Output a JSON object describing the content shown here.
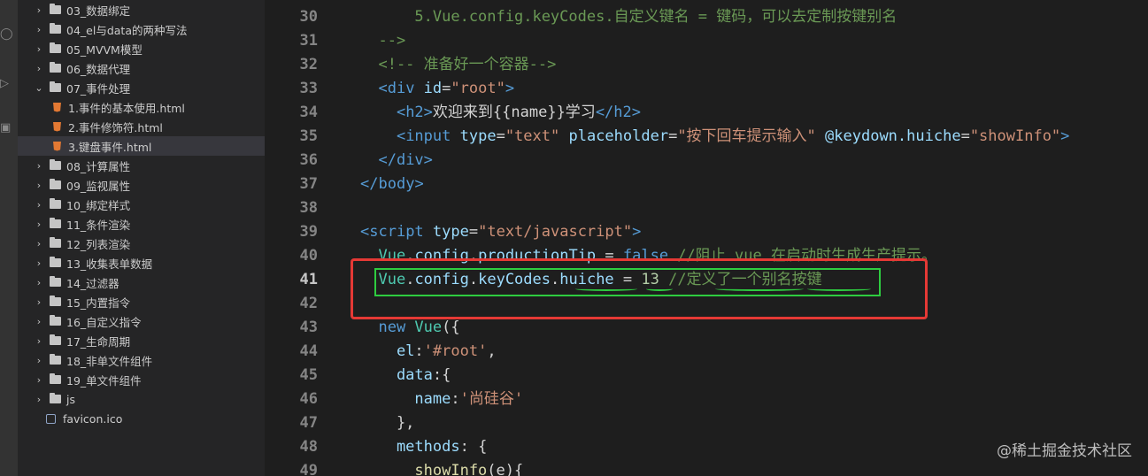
{
  "sidebar": {
    "items": [
      {
        "label": "03_数据绑定",
        "type": "folder",
        "expanded": false,
        "depth": 0
      },
      {
        "label": "04_el与data的两种写法",
        "type": "folder",
        "expanded": false,
        "depth": 0
      },
      {
        "label": "05_MVVM模型",
        "type": "folder",
        "expanded": false,
        "depth": 0
      },
      {
        "label": "06_数据代理",
        "type": "folder",
        "expanded": false,
        "depth": 0
      },
      {
        "label": "07_事件处理",
        "type": "folder",
        "expanded": true,
        "depth": 0
      },
      {
        "label": "1.事件的基本使用.html",
        "type": "html",
        "depth": 1
      },
      {
        "label": "2.事件修饰符.html",
        "type": "html",
        "depth": 1
      },
      {
        "label": "3.键盘事件.html",
        "type": "html",
        "depth": 1,
        "selected": true
      },
      {
        "label": "08_计算属性",
        "type": "folder",
        "expanded": false,
        "depth": 0
      },
      {
        "label": "09_监视属性",
        "type": "folder",
        "expanded": false,
        "depth": 0
      },
      {
        "label": "10_绑定样式",
        "type": "folder",
        "expanded": false,
        "depth": 0
      },
      {
        "label": "11_条件渲染",
        "type": "folder",
        "expanded": false,
        "depth": 0
      },
      {
        "label": "12_列表渲染",
        "type": "folder",
        "expanded": false,
        "depth": 0
      },
      {
        "label": "13_收集表单数据",
        "type": "folder",
        "expanded": false,
        "depth": 0
      },
      {
        "label": "14_过滤器",
        "type": "folder",
        "expanded": false,
        "depth": 0
      },
      {
        "label": "15_内置指令",
        "type": "folder",
        "expanded": false,
        "depth": 0
      },
      {
        "label": "16_自定义指令",
        "type": "folder",
        "expanded": false,
        "depth": 0
      },
      {
        "label": "17_生命周期",
        "type": "folder",
        "expanded": false,
        "depth": 0
      },
      {
        "label": "18_非单文件组件",
        "type": "folder",
        "expanded": false,
        "depth": 0
      },
      {
        "label": "19_单文件组件",
        "type": "folder",
        "expanded": false,
        "depth": 0
      },
      {
        "label": "js",
        "type": "folder",
        "expanded": false,
        "depth": 0
      },
      {
        "label": "favicon.ico",
        "type": "ico",
        "depth": 0
      }
    ]
  },
  "editor": {
    "current_line": "41",
    "lines": [
      {
        "n": "30",
        "tokens": [
          [
            "      5.Vue.config.keyCodes.自定义键名 = 键码，可以去定制按键别名",
            "cmt"
          ]
        ]
      },
      {
        "n": "31",
        "tokens": [
          [
            "  -->",
            "cmt"
          ]
        ]
      },
      {
        "n": "32",
        "tokens": [
          [
            "  <!-- 准备好一个容器-->",
            "cmt"
          ]
        ]
      },
      {
        "n": "33",
        "tokens": [
          [
            "  <",
            "tag"
          ],
          [
            "div",
            "tag"
          ],
          [
            " id",
            "attr"
          ],
          [
            "=",
            "plain"
          ],
          [
            "\"root\"",
            "str"
          ],
          [
            ">",
            "tag"
          ]
        ]
      },
      {
        "n": "34",
        "tokens": [
          [
            "    <",
            "tag"
          ],
          [
            "h2",
            "tag"
          ],
          [
            ">",
            "tag"
          ],
          [
            "欢迎来到{{name}}学习",
            "plain"
          ],
          [
            "</",
            "tag"
          ],
          [
            "h2",
            "tag"
          ],
          [
            ">",
            "tag"
          ]
        ]
      },
      {
        "n": "35",
        "tokens": [
          [
            "    <",
            "tag"
          ],
          [
            "input",
            "tag"
          ],
          [
            " type",
            "attr"
          ],
          [
            "=",
            "plain"
          ],
          [
            "\"text\"",
            "str"
          ],
          [
            " placeholder",
            "attr"
          ],
          [
            "=",
            "plain"
          ],
          [
            "\"按下回车提示输入\"",
            "str"
          ],
          [
            " @keydown.huiche",
            "attr"
          ],
          [
            "=",
            "plain"
          ],
          [
            "\"showInfo\"",
            "str"
          ],
          [
            ">",
            "tag"
          ]
        ]
      },
      {
        "n": "36",
        "tokens": [
          [
            "  </",
            "tag"
          ],
          [
            "div",
            "tag"
          ],
          [
            ">",
            "tag"
          ]
        ]
      },
      {
        "n": "37",
        "tokens": [
          [
            "</",
            "tag"
          ],
          [
            "body",
            "tag"
          ],
          [
            ">",
            "tag"
          ]
        ]
      },
      {
        "n": "38",
        "tokens": []
      },
      {
        "n": "39",
        "tokens": [
          [
            "<",
            "tag"
          ],
          [
            "script",
            "tag"
          ],
          [
            " type",
            "attr"
          ],
          [
            "=",
            "plain"
          ],
          [
            "\"text/javascript\"",
            "str"
          ],
          [
            ">",
            "tag"
          ]
        ]
      },
      {
        "n": "40",
        "tokens": [
          [
            "  Vue",
            "cls"
          ],
          [
            ".",
            "plain"
          ],
          [
            "config",
            "prop"
          ],
          [
            ".",
            "plain"
          ],
          [
            "productionTip",
            "prop"
          ],
          [
            " = ",
            "plain"
          ],
          [
            "false",
            "kw"
          ],
          [
            " //阻止 vue 在启动时生成生产提示。",
            "cmt"
          ]
        ]
      },
      {
        "n": "41",
        "tokens": [
          [
            "  Vue",
            "cls"
          ],
          [
            ".",
            "plain"
          ],
          [
            "config",
            "prop"
          ],
          [
            ".",
            "plain"
          ],
          [
            "keyCodes",
            "prop"
          ],
          [
            ".",
            "plain"
          ],
          [
            "huiche",
            "prop"
          ],
          [
            " = ",
            "plain"
          ],
          [
            "13",
            "num"
          ],
          [
            " //定义了一个别名按键",
            "cmt"
          ]
        ]
      },
      {
        "n": "42",
        "tokens": []
      },
      {
        "n": "43",
        "tokens": [
          [
            "  new",
            "kw"
          ],
          [
            " Vue",
            "cls"
          ],
          [
            "({",
            "plain"
          ]
        ]
      },
      {
        "n": "44",
        "tokens": [
          [
            "    el",
            "prop"
          ],
          [
            ":",
            "plain"
          ],
          [
            "'#root'",
            "str"
          ],
          [
            ",",
            "plain"
          ]
        ]
      },
      {
        "n": "45",
        "tokens": [
          [
            "    data",
            "prop"
          ],
          [
            ":{",
            "plain"
          ]
        ]
      },
      {
        "n": "46",
        "tokens": [
          [
            "      name",
            "prop"
          ],
          [
            ":",
            "plain"
          ],
          [
            "'尚硅谷'",
            "str"
          ]
        ]
      },
      {
        "n": "47",
        "tokens": [
          [
            "    },",
            "plain"
          ]
        ]
      },
      {
        "n": "48",
        "tokens": [
          [
            "    methods",
            "prop"
          ],
          [
            ": {",
            "plain"
          ]
        ]
      },
      {
        "n": "49",
        "tokens": [
          [
            "      showInfo",
            "fn"
          ],
          [
            "(e){",
            "plain"
          ]
        ]
      }
    ]
  },
  "watermark": "@稀土掘金技术社区",
  "colors": {
    "annotation_red": "#e53935",
    "annotation_green": "#2ecc40"
  }
}
